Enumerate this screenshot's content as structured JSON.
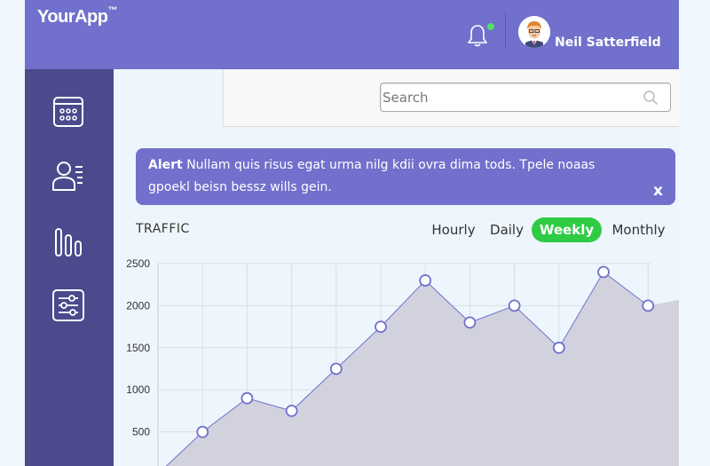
{
  "header": {
    "logo": "YourApp",
    "logo_tm": "™",
    "user_name": "Neil Satterfield",
    "notification_dot_color": "#4fe06a"
  },
  "sidebar": {
    "items": [
      {
        "icon": "calendar-icon"
      },
      {
        "icon": "users-icon"
      },
      {
        "icon": "bar-chart-icon"
      },
      {
        "icon": "settings-sliders-icon"
      }
    ]
  },
  "search": {
    "placeholder": "Search",
    "value": ""
  },
  "alert": {
    "label": "Alert",
    "message": "Nullam quis risus egat urma nilg kdii ovra dima tods. Tpele noaas gpoekl beisn bessz wills gein.",
    "close": "x"
  },
  "traffic": {
    "title": "TRAFFIC",
    "tabs": [
      "Hourly",
      "Daily",
      "Weekly",
      "Monthly"
    ],
    "active_tab": "Weekly"
  },
  "colors": {
    "accent": "#7170cc",
    "sidebar": "#4a4a8c",
    "active_tab": "#2fcb45",
    "area_fill": "#d2d2df"
  },
  "chart_data": {
    "type": "area",
    "x": [
      0,
      1,
      2,
      3,
      4,
      5,
      6,
      7,
      8,
      9,
      10,
      11,
      12
    ],
    "series": [
      {
        "values": [
          0,
          500,
          900,
          750,
          1250,
          1750,
          2300,
          1800,
          2000,
          1500,
          2400,
          2000,
          2100
        ]
      }
    ],
    "y_ticks": [
      "2500",
      "2000",
      "1500",
      "1000",
      "500"
    ],
    "ylim": [
      0,
      2500
    ],
    "grid": true,
    "markers": "hollow circles, last point unmarked"
  }
}
